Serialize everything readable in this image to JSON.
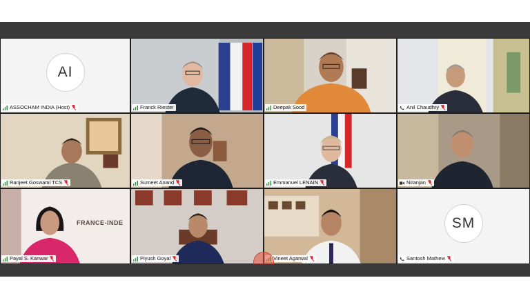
{
  "participants": [
    {
      "name": "ASSOCHAM INDIA (Host)",
      "initials": "AI",
      "video": false
    },
    {
      "name": "Franck Riester",
      "video": true
    },
    {
      "name": "Deepak Sood",
      "video": true
    },
    {
      "name": "Anil Chaudhry",
      "video": true
    },
    {
      "name": "Ranjeet Goswami TCS",
      "video": true
    },
    {
      "name": "Sumeet Anand",
      "video": true
    },
    {
      "name": "Emmanuel LENAIN",
      "video": true
    },
    {
      "name": "Niranjan",
      "video": true
    },
    {
      "name": "Payal S. Kanwar",
      "video": true
    },
    {
      "name": "Piyush Goyal",
      "video": true
    },
    {
      "name": "Vineet Agarwal",
      "video": true
    },
    {
      "name": "Santosh Mathew",
      "initials": "SM",
      "video": false
    }
  ],
  "backdrop_text": "FRANCE-INDE",
  "colors": {
    "frame_bar": "#3a3a3a",
    "muted_mic": "#d9262c",
    "avatar_tile": "#f4f4f4"
  },
  "icons": {
    "connection": "signal-icon",
    "audio": "muted-mic-icon"
  }
}
